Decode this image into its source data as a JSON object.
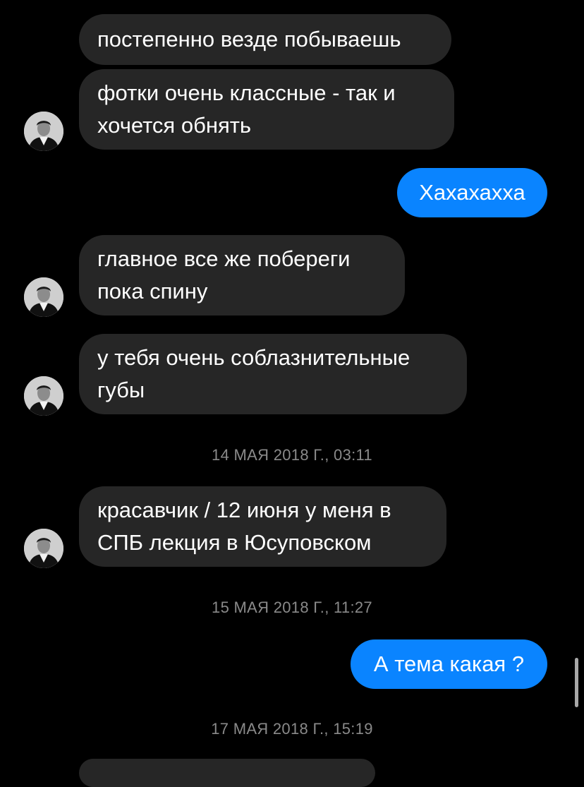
{
  "theme": {
    "background": "#000000",
    "incoming_bubble": "#262626",
    "outgoing_bubble": "#0a84ff",
    "timestamp_color": "#8a8a8a"
  },
  "sender": {
    "avatar_icon": "person-photo-avatar"
  },
  "messages": [
    {
      "direction": "incoming",
      "lines": [
        "постепенно везде побываешь"
      ]
    },
    {
      "direction": "incoming",
      "lines": [
        "фотки очень классные - так и",
        "хочется обнять"
      ]
    },
    {
      "direction": "outgoing",
      "lines": [
        "Хахахахха"
      ]
    },
    {
      "direction": "incoming",
      "lines": [
        "главное все же побереги",
        "пока спину"
      ]
    },
    {
      "direction": "incoming",
      "lines": [
        "у тебя очень соблазнительные",
        "губы"
      ]
    },
    {
      "direction": "incoming",
      "lines": [
        "красавчик / 12 июня у меня в",
        "СПБ лекция в Юсуповском"
      ]
    },
    {
      "direction": "outgoing",
      "lines": [
        "А тема какая ?"
      ]
    }
  ],
  "timestamps": [
    "14 МАЯ 2018 Г., 03:11",
    "15 МАЯ 2018 Г., 11:27",
    "17 МАЯ 2018 Г., 15:19"
  ]
}
